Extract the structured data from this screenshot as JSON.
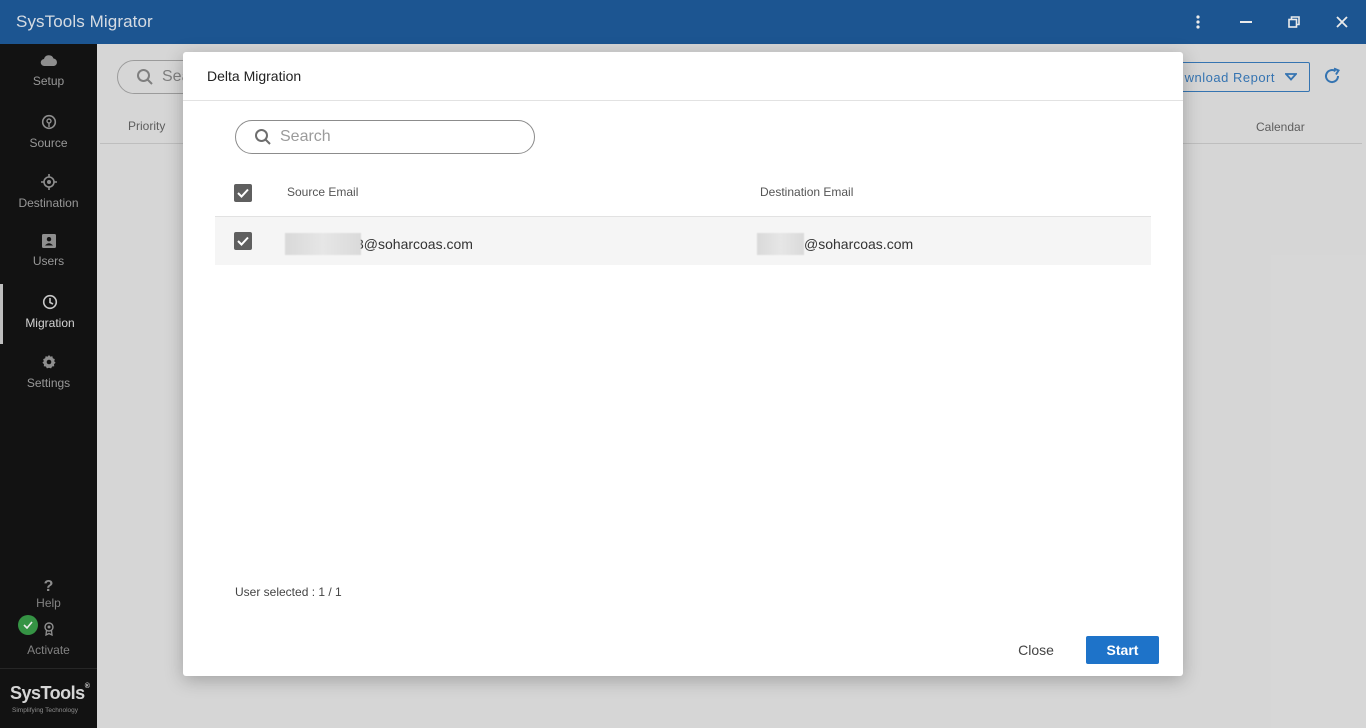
{
  "app": {
    "title": "SysTools Migrator"
  },
  "window_controls": [
    "more-vertical-icon",
    "minimize-icon",
    "restore-icon",
    "close-icon"
  ],
  "sidebar": {
    "items": [
      {
        "label": "Setup",
        "icon": "cloud-icon"
      },
      {
        "label": "Source",
        "icon": "source-icon"
      },
      {
        "label": "Destination",
        "icon": "target-icon"
      },
      {
        "label": "Users",
        "icon": "user-card-icon"
      },
      {
        "label": "Migration",
        "icon": "clock-icon",
        "active": true
      },
      {
        "label": "Settings",
        "icon": "gear-icon"
      }
    ],
    "help_label": "Help",
    "activate_label": "Activate",
    "brand": {
      "name": "SysTools",
      "registered": "®",
      "tagline": "Simplifying Technology"
    }
  },
  "background": {
    "search_placeholder": "Sea",
    "download_report_label": "wnload Report",
    "columns": {
      "priority": "Priority",
      "calendar": "Calendar"
    }
  },
  "dialog": {
    "title": "Delta Migration",
    "search_placeholder": "Search",
    "columns": {
      "source": "Source Email",
      "destination": "Destination Email"
    },
    "rows": [
      {
        "checked": true,
        "source_email": "3@soharcoas.com",
        "destination_email": "@soharcoas.com"
      }
    ],
    "user_selected": "User selected : 1 / 1",
    "close_label": "Close",
    "start_label": "Start"
  },
  "colors": {
    "titlebar": "#1f5d9e",
    "sidebar": "#141414",
    "accent": "#1e73c9",
    "check_badge": "#3aa04a"
  }
}
